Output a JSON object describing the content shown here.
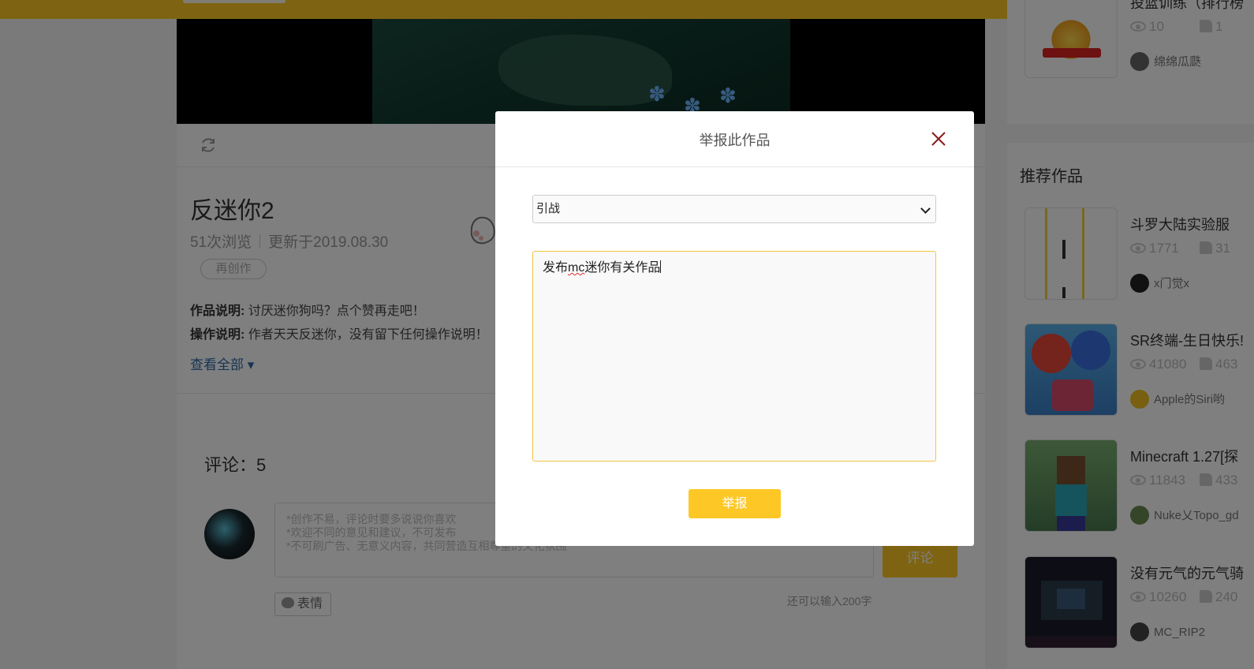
{
  "page": {
    "work_title": "反迷你2",
    "views": "51次浏览",
    "updated": "更新于2019.08.30",
    "recreate_label": "再创作",
    "desc_label": "作品说明:",
    "desc_text": "讨厌迷你狗吗？点个赞再走吧！",
    "ops_label": "操作说明:",
    "ops_text": "作者天天反迷你，没有留下任何操作说明！",
    "see_all": "查看全部 ▾",
    "comments_title": "评论：5",
    "comment_placeholder_1": "*创作不易，评论时要多说说你喜欢",
    "comment_placeholder_2": "*欢迎不同的意见和建议，不可发布",
    "comment_placeholder_3": "*不可刷广告、无意义内容，共同营造互相尊重的文化氛围",
    "comment_submit": "评论",
    "emoji_label": "表情",
    "remaining": "还可以输入200字"
  },
  "sidebar": {
    "top_item": {
      "name": "投篮训练（排行榜",
      "views": "10",
      "likes": "1",
      "author": "绵绵瓜瓞"
    },
    "rec_title": "推荐作品",
    "items": [
      {
        "name": "斗罗大陆实验服",
        "views": "1771",
        "likes": "31",
        "author": "x门觉x"
      },
      {
        "name": "SR终端-生日快乐!",
        "views": "41080",
        "likes": "463",
        "author": "Apple的Siri哟"
      },
      {
        "name": "Minecraft 1.27[探",
        "views": "11843",
        "likes": "433",
        "author": "Nuke乂Topo_gd"
      },
      {
        "name": "没有元气的元气骑",
        "views": "10260",
        "likes": "240",
        "author": "MC_RIP2"
      }
    ]
  },
  "modal": {
    "title": "举报此作品",
    "reason_selected": "引战",
    "text_part1": "发布",
    "text_misspelled": "mc",
    "text_part2": "迷你有关作品",
    "submit_label": "举报"
  },
  "colors": {
    "accent": "#fdc825",
    "close_icon": "#8b1a1a",
    "link": "#2e6aa8",
    "textarea_border": "#f4c542"
  }
}
